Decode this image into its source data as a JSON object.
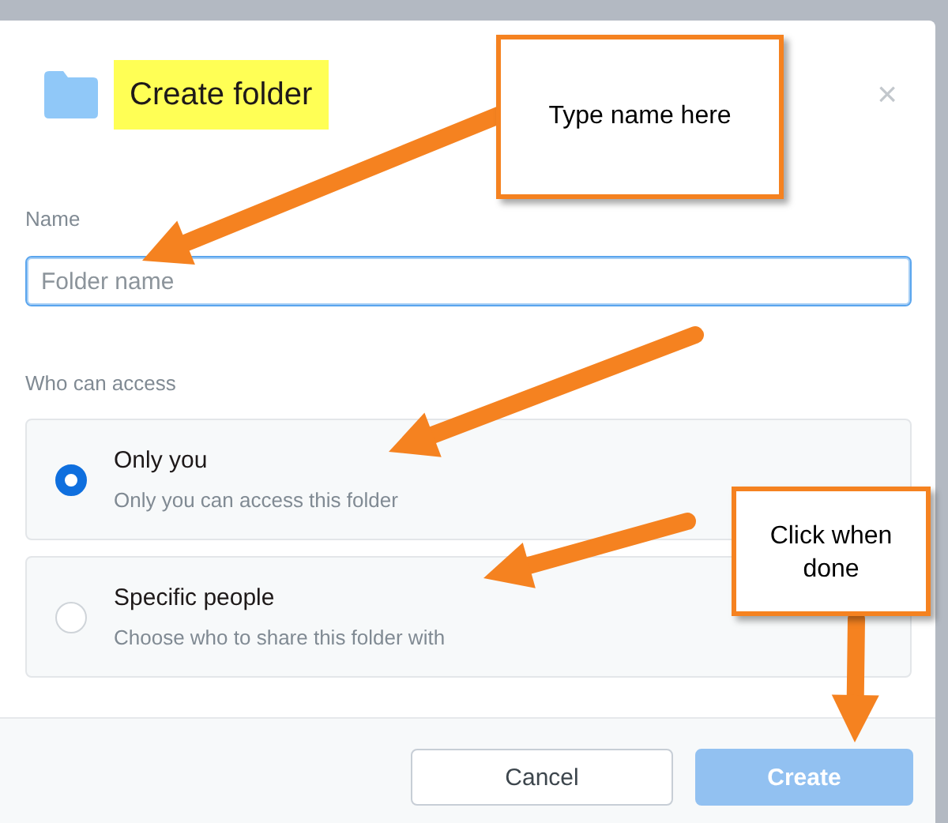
{
  "dialog": {
    "title": "Create folder",
    "title_highlighted": true,
    "close": "×",
    "name_field": {
      "label": "Name",
      "placeholder": "Folder name",
      "focused": true
    },
    "access": {
      "label": "Who can access",
      "options": [
        {
          "title": "Only you",
          "description": "Only you can access this folder",
          "selected": true
        },
        {
          "title": "Specific people",
          "description": "Choose who to share this folder with",
          "selected": false
        }
      ]
    },
    "buttons": [
      {
        "label": "Cancel",
        "kind": "secondary",
        "disabled": false
      },
      {
        "label": "Create",
        "kind": "primary",
        "disabled": true
      }
    ]
  },
  "annotations": [
    {
      "text": "Type name here"
    },
    {
      "text": "Click when done"
    }
  ]
}
